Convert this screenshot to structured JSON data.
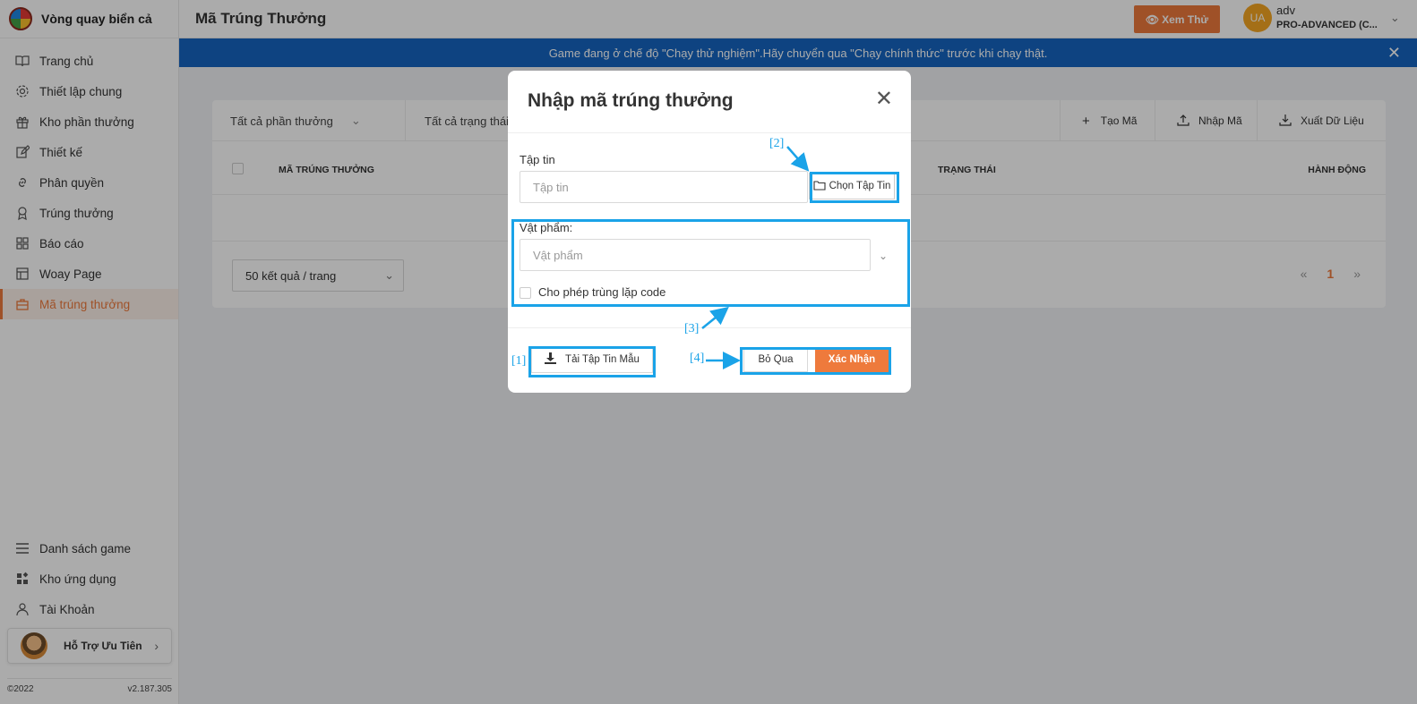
{
  "app": {
    "name": "Vòng quay biển cả"
  },
  "sidebar": {
    "items": [
      {
        "label": "Trang chủ",
        "icon": "book-icon"
      },
      {
        "label": "Thiết lập chung",
        "icon": "gear-icon"
      },
      {
        "label": "Kho phần thưởng",
        "icon": "gift-icon"
      },
      {
        "label": "Thiết kế",
        "icon": "edit-icon"
      },
      {
        "label": "Phân quyền",
        "icon": "link-icon"
      },
      {
        "label": "Trúng thưởng",
        "icon": "award-icon"
      },
      {
        "label": "Báo cáo",
        "icon": "grid-icon"
      },
      {
        "label": "Woay Page",
        "icon": "layout-icon"
      },
      {
        "label": "Mã trúng thưởng",
        "icon": "gift-box-icon",
        "active": true
      }
    ],
    "bottom_items": [
      {
        "label": "Danh sách game",
        "icon": "list-icon"
      },
      {
        "label": "Kho ứng dụng",
        "icon": "apps-icon"
      },
      {
        "label": "Tài Khoản",
        "icon": "user-icon"
      }
    ],
    "support_label": "Hỗ Trợ Ưu Tiên",
    "copyright": "©2022",
    "version": "v2.187.305"
  },
  "header": {
    "title": "Mã Trúng Thưởng",
    "preview_label": "Xem Thử",
    "user": {
      "initials": "UA",
      "name": "adv",
      "plan": "PRO-ADVANCED (C..."
    }
  },
  "banner": {
    "text": "Game đang ở chế độ \"Chạy thử nghiệm\".Hãy chuyển qua \"Chạy chính thức\" trước khi chạy thật.",
    "close": "✕"
  },
  "toolbar": {
    "filter_prize": "Tất cả phần thưởng",
    "filter_status": "Tất cả trạng thái",
    "create_label": "Tạo Mã",
    "import_label": "Nhập Mã",
    "export_label": "Xuất Dữ Liệu"
  },
  "table": {
    "columns": [
      "MÃ TRÚNG THƯỞNG",
      "TRẠNG THÁI",
      "HÀNH ĐỘNG"
    ],
    "rows": []
  },
  "pagination": {
    "page_size_label": "50 kết quả / trang",
    "prev": "«",
    "current": "1",
    "next": "»"
  },
  "modal": {
    "title": "Nhập mã trúng thưởng",
    "file_label": "Tập tin",
    "file_placeholder": "Tập tin",
    "choose_file_label": "Chọn Tập Tin",
    "item_label": "Vật phẩm:",
    "item_placeholder": "Vật phẩm",
    "allow_duplicate_label": "Cho phép trùng lặp code",
    "download_template_label": "Tải Tập Tin Mẫu",
    "skip_label": "Bỏ Qua",
    "confirm_label": "Xác Nhận"
  },
  "annotations": [
    "[1]",
    "[2]",
    "[3]",
    "[4]"
  ],
  "colors": {
    "accent": "#ee7a3c",
    "banner": "#1565c0",
    "annotation": "#1aa3e8"
  }
}
